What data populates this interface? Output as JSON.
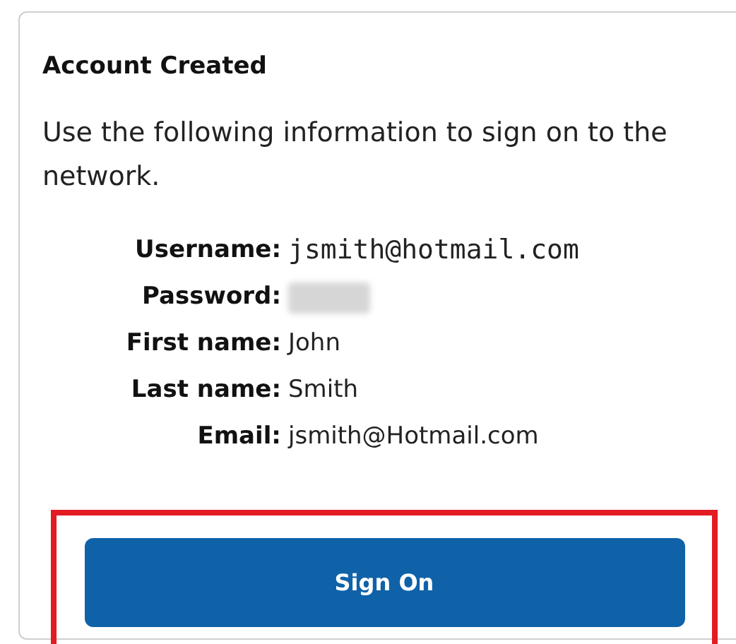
{
  "card": {
    "title": "Account Created",
    "message": "Use the following information to sign on to the network.",
    "fields": [
      {
        "label": "Username:",
        "kind": "mono",
        "value": "jsmith@hotmail.com"
      },
      {
        "label": "Password:",
        "kind": "blurred"
      },
      {
        "label": "First name:",
        "kind": "text",
        "value": "John"
      },
      {
        "label": "Last name:",
        "kind": "text",
        "value": "Smith"
      },
      {
        "label": "Email:",
        "kind": "text",
        "value": "jsmith@Hotmail.com"
      }
    ],
    "button": {
      "label": "Sign On",
      "highlighted": true
    }
  }
}
